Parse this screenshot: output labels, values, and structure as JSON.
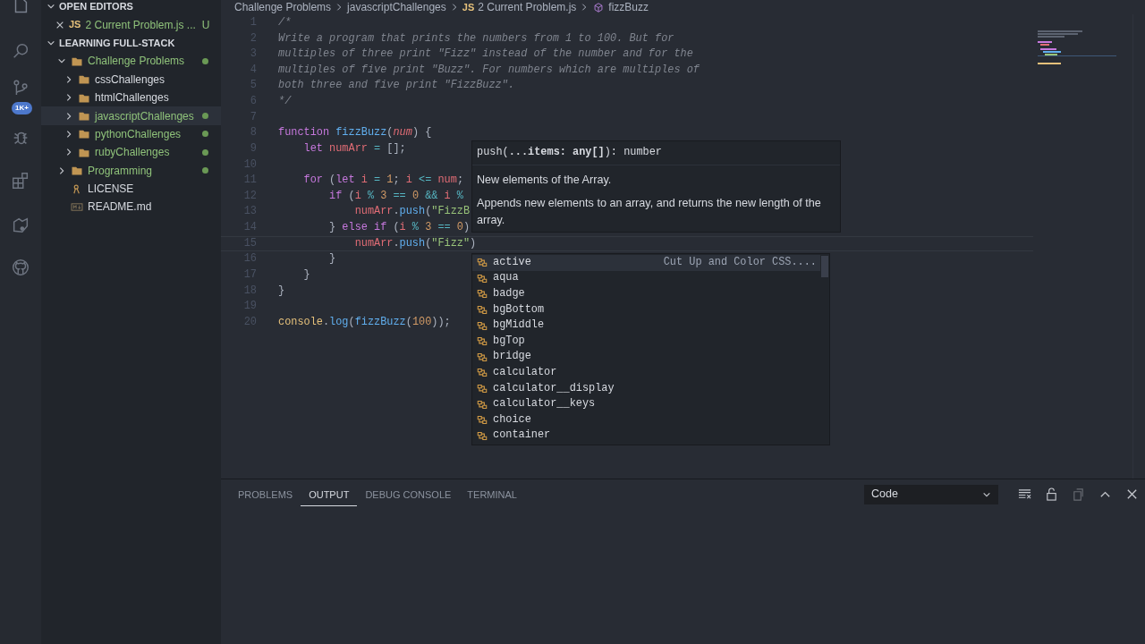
{
  "activity_bar": {
    "items": [
      {
        "kind": "explorer",
        "selected": true
      },
      {
        "kind": "search",
        "selected": false
      },
      {
        "kind": "source-control",
        "selected": false,
        "badge": "1K+"
      },
      {
        "kind": "debug",
        "selected": false
      },
      {
        "kind": "extensions",
        "selected": false
      },
      {
        "kind": "share",
        "selected": false
      },
      {
        "kind": "github",
        "selected": false
      }
    ]
  },
  "sidebar": {
    "sections": [
      {
        "title": "OPEN EDITORS",
        "expanded": true,
        "editors": [
          {
            "file_type": "JS",
            "name": "2 Current Problem.js ...",
            "status": "U"
          }
        ]
      },
      {
        "title": "LEARNING FULL-STACK",
        "expanded": true,
        "tree": [
          {
            "kind": "folder",
            "name": "Challenge Problems",
            "expanded": true,
            "modified": true,
            "selected": false,
            "children": [
              {
                "kind": "folder",
                "name": "cssChallenges",
                "expanded": false,
                "modified": false,
                "selected": false
              },
              {
                "kind": "folder",
                "name": "htmlChallenges",
                "expanded": false,
                "modified": false,
                "selected": false
              },
              {
                "kind": "folder",
                "name": "javascriptChallenges",
                "expanded": false,
                "modified": true,
                "selected": true
              },
              {
                "kind": "folder",
                "name": "pythonChallenges",
                "expanded": false,
                "modified": true,
                "selected": false
              },
              {
                "kind": "folder",
                "name": "rubyChallenges",
                "expanded": false,
                "modified": true,
                "selected": false
              }
            ]
          },
          {
            "kind": "folder",
            "name": "Programming",
            "expanded": false,
            "modified": true,
            "selected": false
          },
          {
            "kind": "license",
            "name": "LICENSE",
            "modified": false,
            "selected": false
          },
          {
            "kind": "markdown",
            "name": "README.md",
            "modified": false,
            "selected": false
          }
        ]
      }
    ]
  },
  "breadcrumbs": [
    {
      "kind": "folder",
      "label": "Challenge Problems"
    },
    {
      "kind": "folder",
      "label": "javascriptChallenges"
    },
    {
      "kind": "file",
      "label": "2 Current Problem.js",
      "file_type": "JS"
    },
    {
      "kind": "symbol",
      "label": "fizzBuzz"
    }
  ],
  "editor": {
    "lines": [
      {
        "number": "1",
        "tokens": [
          {
            "kind": "comment",
            "text": "/*"
          }
        ]
      },
      {
        "number": "2",
        "tokens": [
          {
            "kind": "comment",
            "text": "Write a program that prints the numbers from 1 to 100. But for"
          }
        ]
      },
      {
        "number": "3",
        "tokens": [
          {
            "kind": "comment",
            "text": "multiples of three print \"Fizz\" instead of the number and for the"
          }
        ]
      },
      {
        "number": "4",
        "tokens": [
          {
            "kind": "comment",
            "text": "multiples of five print \"Buzz\". For numbers which are multiples of"
          }
        ]
      },
      {
        "number": "5",
        "tokens": [
          {
            "kind": "comment",
            "text": "both three and five print \"FizzBuzz\"."
          }
        ]
      },
      {
        "number": "6",
        "tokens": [
          {
            "kind": "comment",
            "text": "*/"
          }
        ]
      },
      {
        "number": "7"
      },
      {
        "number": "8",
        "tokens": [
          {
            "kind": "keyword",
            "text": "function "
          },
          {
            "kind": "function",
            "text": "fizzBuzz"
          },
          {
            "kind": "plain",
            "text": "("
          },
          {
            "kind": "param",
            "text": "num"
          },
          {
            "kind": "plain",
            "text": ") {"
          }
        ]
      },
      {
        "number": "9",
        "tokens": [
          {
            "kind": "keyword",
            "text": "    let "
          },
          {
            "kind": "variable",
            "text": "numArr"
          },
          {
            "kind": "operator",
            "text": " = "
          },
          {
            "kind": "plain",
            "text": "[];"
          }
        ]
      },
      {
        "number": "10"
      },
      {
        "number": "11",
        "tokens": [
          {
            "kind": "keyword",
            "text": "    for "
          },
          {
            "kind": "plain",
            "text": "("
          },
          {
            "kind": "keyword",
            "text": "let "
          },
          {
            "kind": "variable",
            "text": "i"
          },
          {
            "kind": "operator",
            "text": " = "
          },
          {
            "kind": "number",
            "text": "1"
          },
          {
            "kind": "plain",
            "text": "; "
          },
          {
            "kind": "variable",
            "text": "i"
          },
          {
            "kind": "operator",
            "text": " <= "
          },
          {
            "kind": "variable",
            "text": "num"
          },
          {
            "kind": "plain",
            "text": ";"
          }
        ]
      },
      {
        "number": "12",
        "tokens": [
          {
            "kind": "keyword",
            "text": "        if "
          },
          {
            "kind": "plain",
            "text": "("
          },
          {
            "kind": "variable",
            "text": "i"
          },
          {
            "kind": "operator",
            "text": " % "
          },
          {
            "kind": "number",
            "text": "3"
          },
          {
            "kind": "operator",
            "text": " == "
          },
          {
            "kind": "number",
            "text": "0"
          },
          {
            "kind": "operator",
            "text": " && "
          },
          {
            "kind": "variable",
            "text": "i"
          },
          {
            "kind": "operator",
            "text": " %"
          }
        ]
      },
      {
        "number": "13",
        "tokens": [
          {
            "kind": "variable",
            "text": "            numArr"
          },
          {
            "kind": "plain",
            "text": "."
          },
          {
            "kind": "function",
            "text": "push"
          },
          {
            "kind": "plain",
            "text": "("
          },
          {
            "kind": "string",
            "text": "\"FizzB"
          }
        ]
      },
      {
        "number": "14",
        "tokens": [
          {
            "kind": "plain",
            "text": "        } "
          },
          {
            "kind": "keyword",
            "text": "else if "
          },
          {
            "kind": "plain",
            "text": "("
          },
          {
            "kind": "variable",
            "text": "i"
          },
          {
            "kind": "operator",
            "text": " % "
          },
          {
            "kind": "number",
            "text": "3"
          },
          {
            "kind": "operator",
            "text": " == "
          },
          {
            "kind": "number",
            "text": "0"
          },
          {
            "kind": "plain",
            "text": ")"
          }
        ]
      },
      {
        "number": "15",
        "active": true,
        "tokens": [
          {
            "kind": "variable",
            "text": "            numArr"
          },
          {
            "kind": "plain",
            "text": "."
          },
          {
            "kind": "function",
            "text": "push"
          },
          {
            "kind": "plain",
            "text": "("
          },
          {
            "kind": "string",
            "text": "\"Fizz\""
          },
          {
            "kind": "plain",
            "text": ")"
          }
        ]
      },
      {
        "number": "16",
        "tokens": [
          {
            "kind": "plain",
            "text": "        }"
          }
        ]
      },
      {
        "number": "17",
        "tokens": [
          {
            "kind": "plain",
            "text": "    }"
          }
        ]
      },
      {
        "number": "18",
        "tokens": [
          {
            "kind": "plain",
            "text": "}"
          }
        ]
      },
      {
        "number": "19"
      },
      {
        "number": "20",
        "tokens": [
          {
            "kind": "object",
            "text": "console"
          },
          {
            "kind": "plain",
            "text": "."
          },
          {
            "kind": "function",
            "text": "log"
          },
          {
            "kind": "plain",
            "text": "("
          },
          {
            "kind": "function",
            "text": "fizzBuzz"
          },
          {
            "kind": "plain",
            "text": "("
          },
          {
            "kind": "number",
            "text": "100"
          },
          {
            "kind": "plain",
            "text": "));"
          }
        ]
      }
    ]
  },
  "hover": {
    "signature": "push(**...items: any[]**): number",
    "summary": "New elements of the Array.",
    "description": "Appends new elements to an array, and returns the new length of the array."
  },
  "suggestions": [
    {
      "label": "active",
      "detail": "Cut Up and Color CSS....",
      "selected": true
    },
    {
      "label": "aqua",
      "selected": false
    },
    {
      "label": "badge",
      "selected": false
    },
    {
      "label": "bgBottom",
      "selected": false
    },
    {
      "label": "bgMiddle",
      "selected": false
    },
    {
      "label": "bgTop",
      "selected": false
    },
    {
      "label": "bridge",
      "selected": false
    },
    {
      "label": "calculator",
      "selected": false
    },
    {
      "label": "calculator__display",
      "selected": false
    },
    {
      "label": "calculator__keys",
      "selected": false
    },
    {
      "label": "choice",
      "selected": false
    },
    {
      "label": "container",
      "selected": false
    }
  ],
  "panel": {
    "tabs": [
      {
        "label": "PROBLEMS",
        "selected": false
      },
      {
        "label": "OUTPUT",
        "selected": true
      },
      {
        "label": "DEBUG CONSOLE",
        "selected": false
      },
      {
        "label": "TERMINAL",
        "selected": false
      }
    ],
    "channel": "Code",
    "actions": [
      {
        "kind": "clear",
        "disabled": false
      },
      {
        "kind": "lock",
        "disabled": false
      },
      {
        "kind": "copy",
        "disabled": true
      },
      {
        "kind": "maximize",
        "disabled": false
      },
      {
        "kind": "close",
        "disabled": false
      }
    ]
  }
}
